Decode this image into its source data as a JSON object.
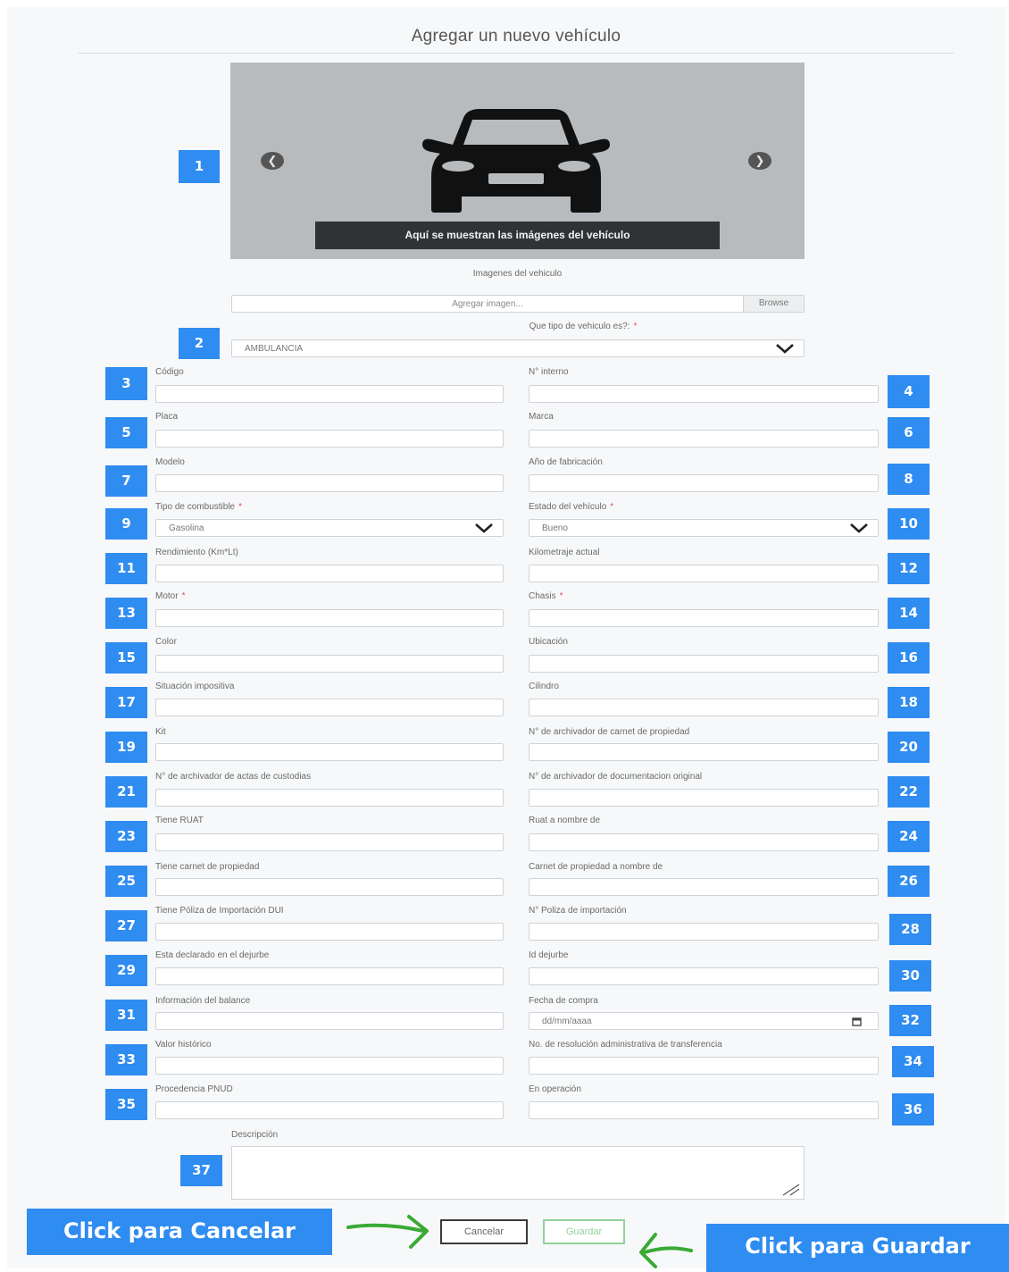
{
  "page": {
    "title": "Agregar un nuevo vehículo"
  },
  "carousel": {
    "caption": "Aquí se muestran las imágenes del vehículo",
    "prev_icon": "chevron-left-icon",
    "next_icon": "chevron-right-icon",
    "image_icon": "car-front-icon"
  },
  "images": {
    "label": "Imagenes del vehiculo",
    "placeholder": "Agregar imagen...",
    "browse_label": "Browse"
  },
  "vehicle_type": {
    "label": "Que tipo de vehiculo es?:",
    "required_mark": "*",
    "value": "AMBULANCIA"
  },
  "fields": {
    "codigo": {
      "label": "Código",
      "value": ""
    },
    "n_interno": {
      "label": "N° interno",
      "value": ""
    },
    "placa": {
      "label": "Placa",
      "value": ""
    },
    "marca": {
      "label": "Marca",
      "value": ""
    },
    "modelo": {
      "label": "Modelo",
      "value": ""
    },
    "anio": {
      "label": "Año de fabricación",
      "value": ""
    },
    "combustible": {
      "label": "Tipo de combustible",
      "required_mark": "*",
      "value": "Gasolina"
    },
    "estado": {
      "label": "Estado del vehículo",
      "required_mark": "*",
      "value": "Bueno"
    },
    "rendimiento": {
      "label": "Rendimiento (Km*Lt)",
      "value": ""
    },
    "kilometraje": {
      "label": "Kilometraje actual",
      "value": ""
    },
    "motor": {
      "label": "Motor",
      "required_mark": "*",
      "value": ""
    },
    "chasis": {
      "label": "Chasis",
      "required_mark": "*",
      "value": ""
    },
    "color": {
      "label": "Color",
      "value": ""
    },
    "ubicacion": {
      "label": "Ubicación",
      "value": ""
    },
    "situacion": {
      "label": "Situación impositiva",
      "value": ""
    },
    "cilindro": {
      "label": "Cilindro",
      "value": ""
    },
    "kit": {
      "label": "Kit",
      "value": ""
    },
    "archivador_carnet": {
      "label": "N° de archivador de carnet de propiedad",
      "value": ""
    },
    "archivador_actas": {
      "label": "N° de archivador de actas de custodias",
      "value": ""
    },
    "archivador_doc": {
      "label": "N° de archivador de documentacion original",
      "value": ""
    },
    "tiene_ruat": {
      "label": "Tiene RUAT",
      "value": ""
    },
    "ruat_nombre": {
      "label": "Ruat a nombre de",
      "value": ""
    },
    "tiene_carnet": {
      "label": "Tiene carnet de propiedad",
      "value": ""
    },
    "carnet_nombre": {
      "label": "Carnet de propiedad a nombre de",
      "value": ""
    },
    "tiene_poliza": {
      "label": "Tiene Póliza de Importación DUI",
      "value": ""
    },
    "n_poliza": {
      "label": "N° Poliza de importación",
      "value": ""
    },
    "dejurbe": {
      "label": "Esta declarado en el dejurbe",
      "value": ""
    },
    "id_dejurbe": {
      "label": "Id dejurbe",
      "value": ""
    },
    "balance": {
      "label": "Información del balance",
      "value": ""
    },
    "fecha_compra": {
      "label": "Fecha de compra",
      "placeholder": "dd/mm/aaaa",
      "calendar_icon": "calendar-icon"
    },
    "valor": {
      "label": "Valor histórico",
      "value": ""
    },
    "resolucion": {
      "label": "No. de resolución administrativa de transferencia",
      "value": ""
    },
    "procedencia": {
      "label": "Procedencia PNUD",
      "value": ""
    },
    "operacion": {
      "label": "En operación",
      "value": ""
    },
    "descripcion": {
      "label": "Descripción",
      "value": ""
    }
  },
  "buttons": {
    "cancel": "Cancelar",
    "save": "Guardar"
  },
  "callouts": {
    "cancel": "Click para Cancelar",
    "save": "Click para Guardar"
  },
  "badges": [
    "1",
    "2",
    "3",
    "4",
    "5",
    "6",
    "7",
    "8",
    "9",
    "10",
    "11",
    "12",
    "13",
    "14",
    "15",
    "16",
    "17",
    "18",
    "19",
    "20",
    "21",
    "22",
    "23",
    "24",
    "25",
    "26",
    "27",
    "28",
    "29",
    "30",
    "31",
    "32",
    "33",
    "34",
    "35",
    "36",
    "37"
  ],
  "colors": {
    "badge": "#2f8cf0",
    "save_button": "#8fd39a",
    "arrow": "#3aaa35",
    "required": "#e0506a"
  }
}
